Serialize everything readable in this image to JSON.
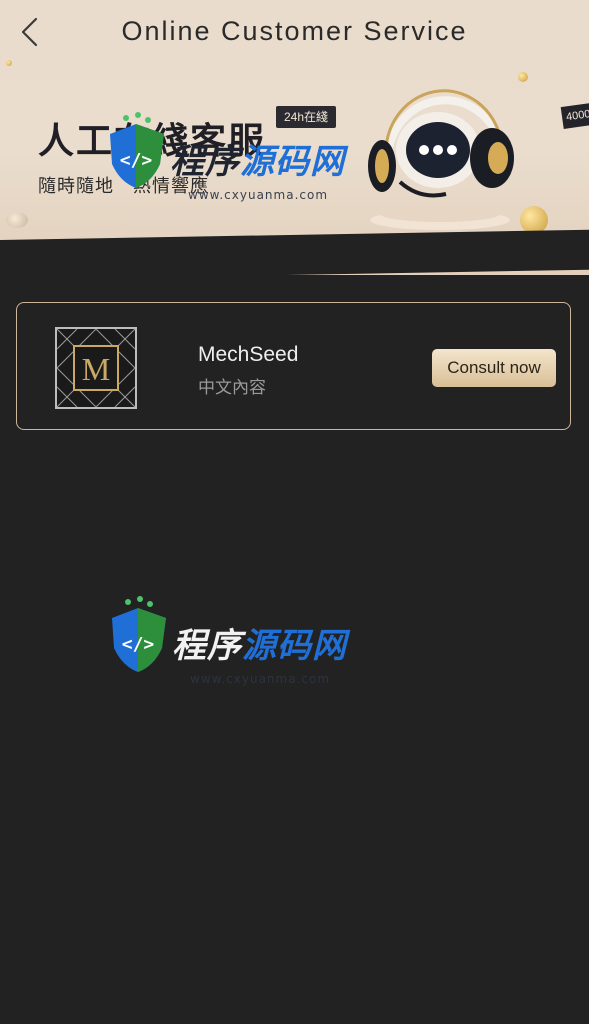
{
  "header": {
    "title": "Online Customer Service",
    "back_icon": "chevron-left-icon"
  },
  "banner": {
    "title": "人工在綫客服",
    "badge": "24h在綫",
    "subtitle": "隨時隨地　熱情響應",
    "corner_tag": "4000",
    "art_icon": "headset-chat-icon"
  },
  "service_list": [
    {
      "name": "MechSeed",
      "description": "中文內容",
      "avatar_letter": "M",
      "action_label": "Consult now"
    }
  ],
  "watermark": {
    "brand": "程序源码网",
    "url": "www.cxyuanma.com",
    "icon": "code-shield-icon"
  },
  "colors": {
    "background": "#222222",
    "banner": "#eaddcd",
    "card_border": "#cdb699",
    "button_gold": "#d9bf96",
    "watermark_blue": "#1f6fd6"
  }
}
